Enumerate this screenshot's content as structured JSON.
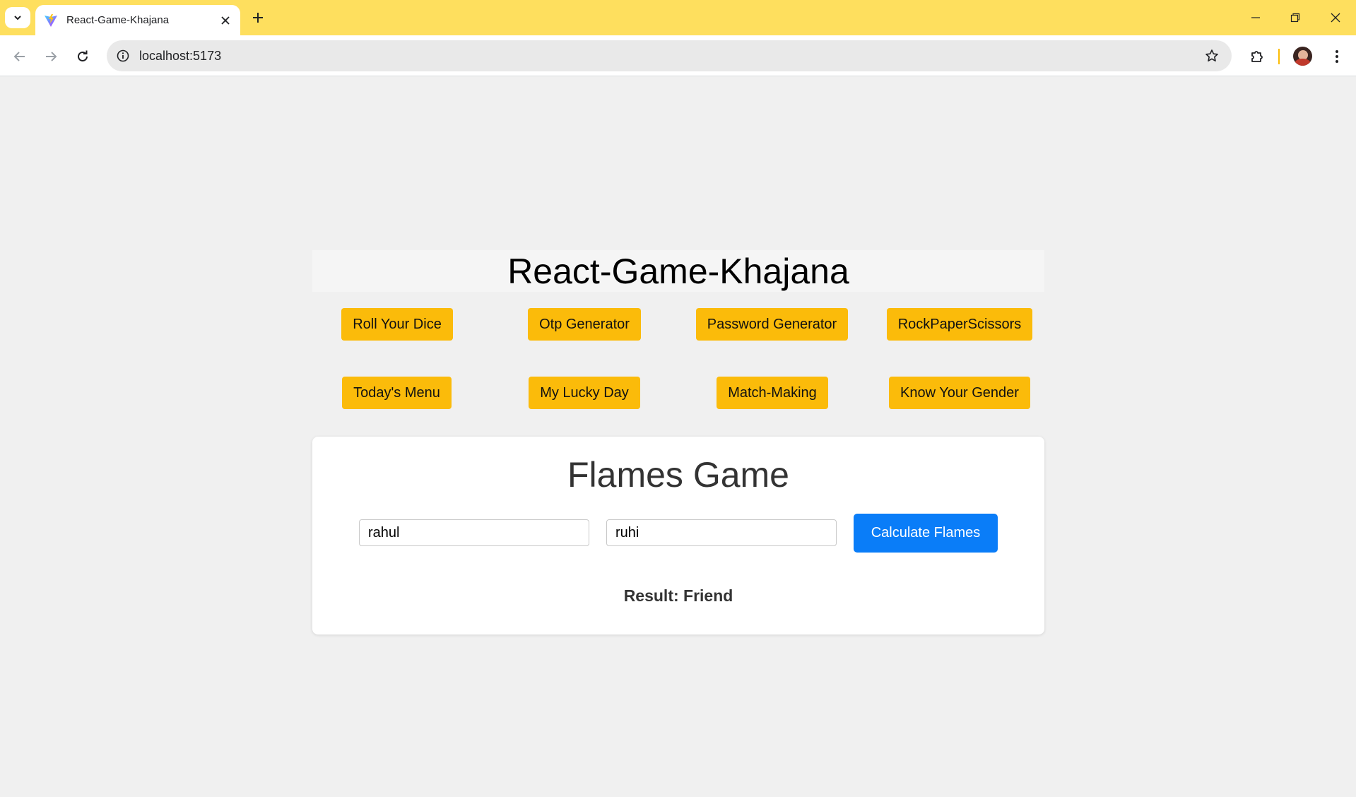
{
  "browser": {
    "tab_title": "React-Game-Khajana",
    "url": "localhost:5173",
    "icons": {
      "tab_dropdown": "chevron-down-icon",
      "favicon": "vite-logo-icon",
      "tab_close": "close-icon",
      "new_tab": "plus-icon",
      "back": "arrow-left-icon",
      "forward": "arrow-right-icon",
      "reload": "reload-icon",
      "site_info": "info-icon",
      "bookmark": "star-icon",
      "extensions": "puzzle-icon",
      "menu": "kebab-menu-icon"
    },
    "colors": {
      "tabbar": "#fedf5e",
      "omnibox": "#e9e9e9"
    }
  },
  "app": {
    "title": "React-Game-Khajana",
    "nav_buttons": [
      "Roll Your Dice",
      "Otp Generator",
      "Password Generator",
      "RockPaperScissors",
      "Today's Menu",
      "My Lucky Day",
      "Match-Making",
      "Know Your Gender"
    ],
    "colors": {
      "nav_button": "#fbbb0a",
      "primary_button": "#0a7df8"
    }
  },
  "flames": {
    "title": "Flames Game",
    "name1_value": "rahul",
    "name2_value": "ruhi",
    "calculate_label": "Calculate Flames",
    "result_text": "Result: Friend"
  }
}
